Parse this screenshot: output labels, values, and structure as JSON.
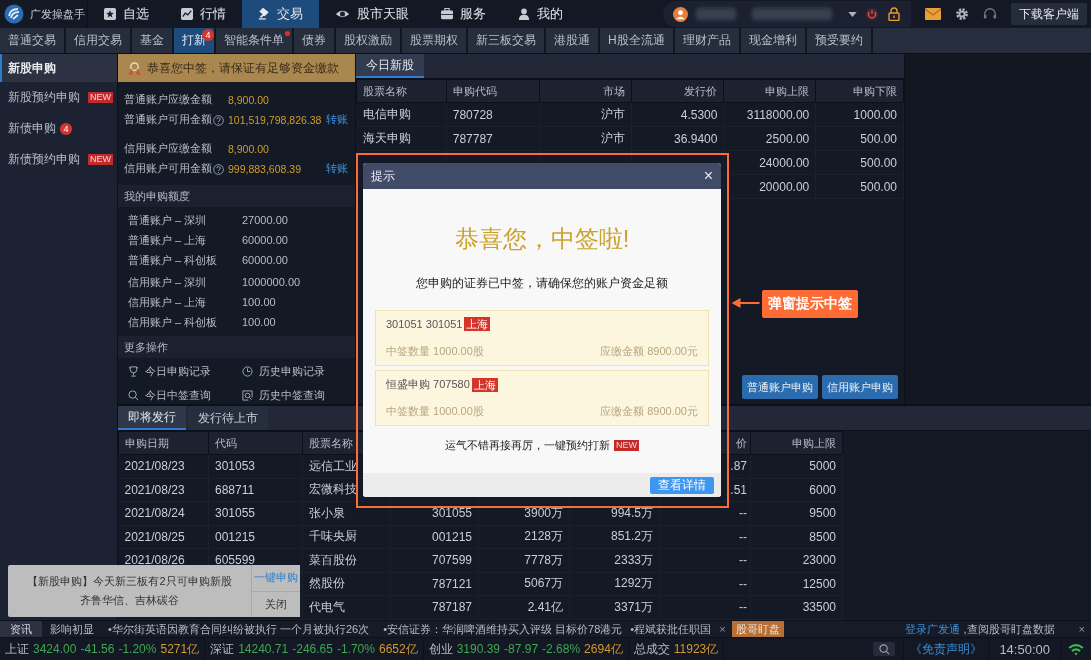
{
  "app": {
    "name": "广发操盘手"
  },
  "main_nav": [
    {
      "label": "自选",
      "selected": false
    },
    {
      "label": "行情",
      "selected": false
    },
    {
      "label": "交易",
      "selected": true
    },
    {
      "label": "股市天眼",
      "selected": false
    },
    {
      "label": "服务",
      "selected": false
    },
    {
      "label": "我的",
      "selected": false
    }
  ],
  "download_button": "下载客户端",
  "sub_tabs": [
    {
      "label": "普通交易",
      "selected": false,
      "dot": false
    },
    {
      "label": "信用交易",
      "selected": false,
      "dot": false
    },
    {
      "label": "基金",
      "selected": false,
      "dot": false
    },
    {
      "label": "打新",
      "selected": true,
      "dot": false,
      "badge": "4"
    },
    {
      "label": "智能条件单",
      "selected": false,
      "dot": true
    },
    {
      "label": "债券",
      "selected": false,
      "dot": false
    },
    {
      "label": "股权激励",
      "selected": false,
      "dot": false
    },
    {
      "label": "股票期权",
      "selected": false,
      "dot": false
    },
    {
      "label": "新三板交易",
      "selected": false,
      "dot": false
    },
    {
      "label": "港股通",
      "selected": false,
      "dot": false
    },
    {
      "label": "H股全流通",
      "selected": false,
      "dot": false
    },
    {
      "label": "理财产品",
      "selected": false,
      "dot": false
    },
    {
      "label": "现金增利",
      "selected": false,
      "dot": false
    },
    {
      "label": "预受要约",
      "selected": false,
      "dot": false
    }
  ],
  "sidebar": {
    "items": [
      {
        "label": "新股申购",
        "selected": true
      },
      {
        "label": "新股预约申购",
        "selected": false,
        "tag": "NEW"
      },
      {
        "label": "新债申购",
        "selected": false,
        "badge": "4"
      },
      {
        "label": "新债预约申购",
        "selected": false,
        "tag": "NEW"
      }
    ]
  },
  "notice_banner": "恭喜您中签，请保证有足够资金缴款",
  "accounts": [
    {
      "label": "普通账户应缴金额",
      "value": "8,900.00",
      "help": false
    },
    {
      "label": "普通账户可用金额",
      "value": "101,519,798,826.38",
      "help": true,
      "link": "转账"
    },
    {
      "label": "信用账户应缴金额",
      "value": "8,900.00",
      "help": false
    },
    {
      "label": "信用账户可用金额",
      "value": "999,883,608.39",
      "help": true,
      "link": "转账"
    }
  ],
  "quota": {
    "title": "我的申购额度",
    "rows": [
      {
        "label": "普通账户 – 深圳",
        "value": "27000.00"
      },
      {
        "label": "普通账户 – 上海",
        "value": "60000.00"
      },
      {
        "label": "普通账户 – 科创板",
        "value": "60000.00"
      },
      {
        "label": "信用账户 – 深圳",
        "value": "1000000.00"
      },
      {
        "label": "信用账户 – 上海",
        "value": "100.00"
      },
      {
        "label": "信用账户 – 科创板",
        "value": "100.00"
      }
    ]
  },
  "more_actions": {
    "title": "更多操作",
    "links": [
      "今日申购记录",
      "历史申购记录",
      "今日中签查询",
      "历史中签查询"
    ]
  },
  "today_ipo": {
    "tabs": [
      {
        "label": "今日新股",
        "selected": true
      }
    ],
    "columns": [
      "股票名称",
      "申购代码",
      "市场",
      "发行价",
      "申购上限",
      "申购下限"
    ],
    "rows": [
      [
        "电信申购",
        "780728",
        "沪市",
        "4.5300",
        "3118000.00",
        "1000.00"
      ],
      [
        "海天申购",
        "787787",
        "沪市",
        "36.9400",
        "2500.00",
        "500.00"
      ],
      [
        null,
        null,
        null,
        null,
        "24000.00",
        "500.00"
      ],
      [
        null,
        null,
        null,
        null,
        "20000.00",
        "500.00"
      ]
    ],
    "buttons": [
      "普通账户申购",
      "信用账户申购"
    ]
  },
  "upcoming": {
    "tabs": [
      {
        "label": "即将发行",
        "selected": true
      },
      {
        "label": "发行待上市",
        "selected": false
      }
    ],
    "columns": [
      "申购日期",
      "代码",
      "股票名称",
      null,
      null,
      null,
      "价",
      "申购上限"
    ],
    "rows": [
      [
        "2021/08/23",
        "301053",
        "远信工业",
        null,
        null,
        null,
        ".87",
        "5000"
      ],
      [
        "2021/08/23",
        "688711",
        "宏微科技",
        null,
        null,
        null,
        ".51",
        "6000"
      ],
      [
        "2021/08/24",
        "301055",
        "张小泉",
        "301055",
        "3900万",
        "994.5万",
        "--",
        "9500"
      ],
      [
        "2021/08/25",
        "001215",
        "千味央厨",
        "001215",
        "2128万",
        "851.2万",
        "--",
        "8500"
      ],
      [
        "2021/08/26",
        "605599",
        "菜百股份",
        "707599",
        "7778万",
        "2333万",
        "--",
        "23000"
      ],
      [
        null,
        null,
        "然股份",
        "787121",
        "5067万",
        "1292万",
        "--",
        "12500"
      ],
      [
        null,
        null,
        "代电气",
        "787187",
        "2.41亿",
        "3371万",
        "--",
        "33500"
      ]
    ]
  },
  "ticker": {
    "label": "资讯",
    "items": [
      "影响初显",
      "•华尔街英语因教育合同纠纷被执行 一个月被执行26次",
      "•安信证券：华润啤酒维持买入评级 目标价78港元",
      "•程斌获批任职国"
    ],
    "close": "×",
    "watch_badge": "股哥盯盘",
    "login_link": "登录广发通",
    "login_text": ",查阅股哥盯盘数据",
    "close_right": "×"
  },
  "status_bar": {
    "indices": [
      {
        "name": "上证",
        "price": "3424.00",
        "change": "-41.56",
        "pct": "-1.20%",
        "volume": "5271亿"
      },
      {
        "name": "深证",
        "price": "14240.71",
        "change": "-246.65",
        "pct": "-1.70%",
        "volume": "6652亿"
      },
      {
        "name": "创业",
        "price": "3190.39",
        "change": "-87.97",
        "pct": "-2.68%",
        "volume": "2694亿"
      }
    ],
    "total": {
      "label": "总成交",
      "value": "11923亿"
    },
    "disclaimer": "《免责声明》",
    "time": "14:50:00"
  },
  "dialog": {
    "title": "提示",
    "close": "×",
    "headline": "恭喜您，中签啦!",
    "message": "您申购的证券已中签，请确保您的账户资金足额",
    "items": [
      {
        "name": "301051 301051",
        "market": "上海",
        "quantity": "中签数量 1000.00股",
        "amount": "应缴金额 8900.00元"
      },
      {
        "name": "恒盛申购 707580",
        "market": "上海",
        "quantity": "中签数量 1000.00股",
        "amount": "应缴金额 8900.00元"
      }
    ],
    "promo": "运气不错再接再厉，一键预约打新",
    "promo_tag": "NEW",
    "button": "查看详情"
  },
  "annotation": {
    "label": "弹窗提示中签"
  },
  "toast": {
    "lines": [
      "【新股申购】今天新三板有2只可申购新股",
      "齐鲁华信、吉林碳谷"
    ],
    "action": "一键申购",
    "close": "关闭"
  }
}
